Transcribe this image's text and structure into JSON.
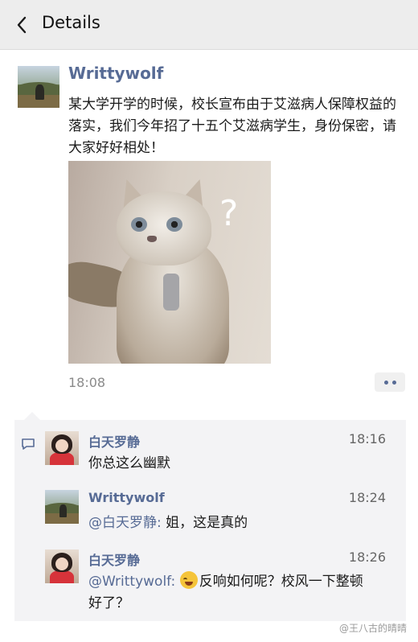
{
  "nav": {
    "title": "Details"
  },
  "post": {
    "author": "Writtywolf",
    "text": "某大学开学的时候，校长宣布由于艾滋病人保障权益的落实，我们今年招了十五个艾滋病学生，身份保密，请大家好好相处！",
    "image_overlay": "?",
    "time": "18:08"
  },
  "comments": [
    {
      "name": "白天罗静",
      "time": "18:16",
      "mention": "",
      "text": "你总这么幽默"
    },
    {
      "name": "Writtywolf",
      "time": "18:24",
      "mention": "@白天罗静:",
      "text": " 姐，这是真的"
    },
    {
      "name": "白天罗静",
      "time": "18:26",
      "mention": "@Writtywolf:",
      "text": "反响如何呢？校风一下整顿好了？"
    }
  ],
  "watermark": "@王八古的晴晴",
  "icons": {
    "back": "chevron-left-icon",
    "more": "more-dots-icon",
    "comment": "comment-icon",
    "emoji": "laughing-emoji-icon"
  },
  "colors": {
    "link": "#576b95",
    "nav_bg": "#ededed",
    "comment_bg": "#f3f3f5"
  }
}
